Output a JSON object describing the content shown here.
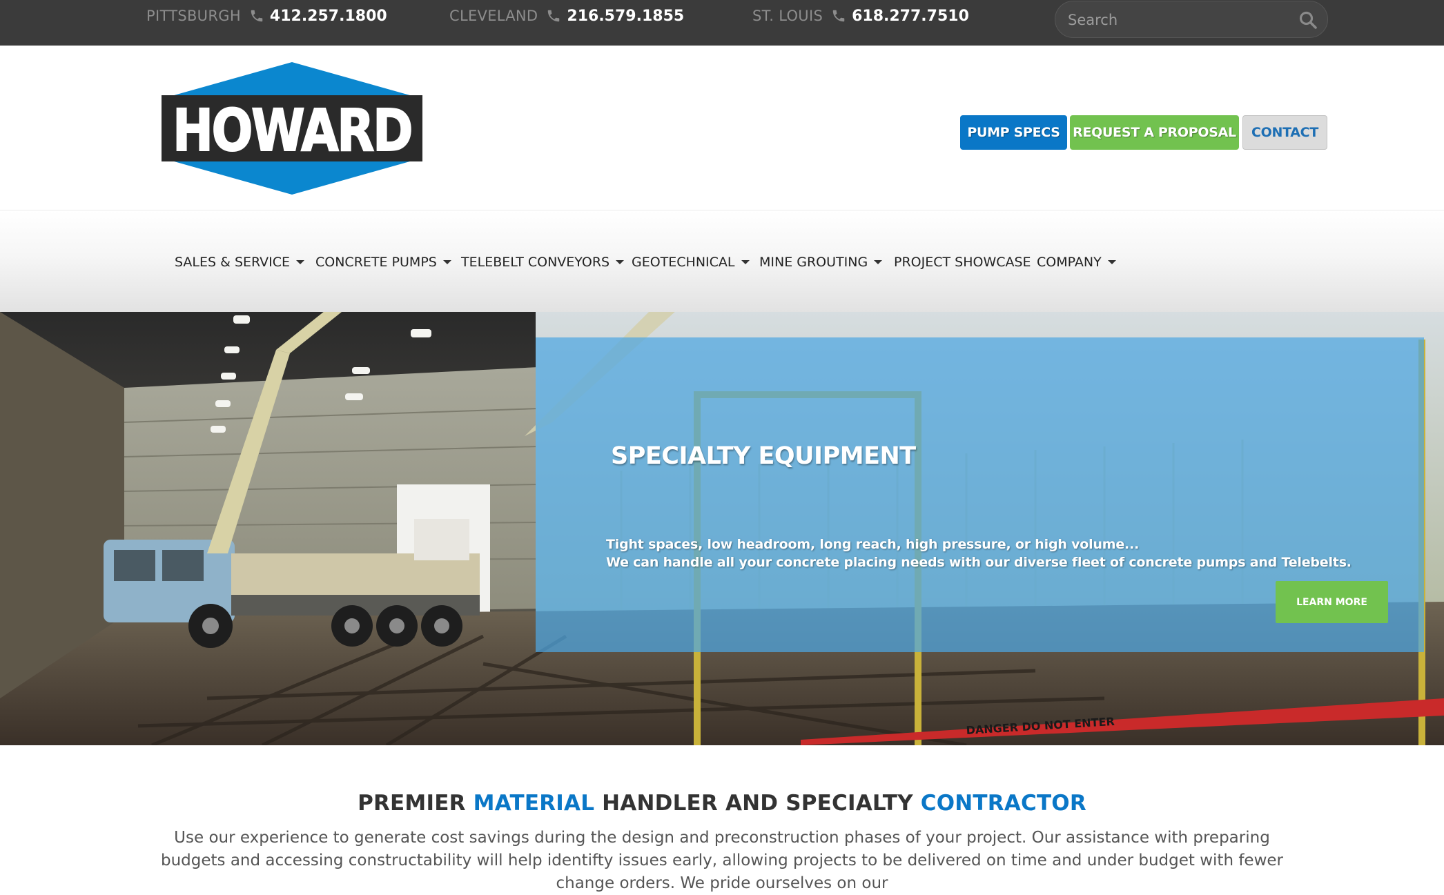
{
  "colors": {
    "topbar_bg": "#3b3b3b",
    "brand_blue": "#0a77c7",
    "brand_green": "#72c24f",
    "panel_blue": "#4ea6e2"
  },
  "topbar": {
    "locations": [
      {
        "city": "PITTSBURGH",
        "phone": "412.257.1800",
        "icon": "phone-icon"
      },
      {
        "city": "CLEVELAND",
        "phone": "216.579.1855",
        "icon": "phone-icon"
      },
      {
        "city": "ST. LOUIS",
        "phone": "618.277.7510",
        "icon": "phone-icon"
      }
    ],
    "search": {
      "placeholder": "Search",
      "icon": "search-icon"
    }
  },
  "header": {
    "logo_text": "HOWARD",
    "buttons": {
      "pump_specs": "PUMP SPECS",
      "request_proposal": "REQUEST A PROPOSAL",
      "contact": "CONTACT"
    }
  },
  "nav": {
    "items": [
      {
        "label": "SALES & SERVICE",
        "dropdown": true
      },
      {
        "label": "CONCRETE PUMPS",
        "dropdown": true
      },
      {
        "label": "TELEBELT CONVEYORS",
        "dropdown": true
      },
      {
        "label": "GEOTECHNICAL",
        "dropdown": true
      },
      {
        "label": "MINE GROUTING",
        "dropdown": true
      },
      {
        "label": "PROJECT SHOWCASE",
        "dropdown": false
      },
      {
        "label": "COMPANY",
        "dropdown": true
      }
    ]
  },
  "hero": {
    "title": "SPECIALTY EQUIPMENT",
    "line1": "Tight spaces, low headroom, long reach, high pressure, or high volume...",
    "line2": "We can handle all your concrete placing needs with our diverse fleet of concrete pumps and Telebelts.",
    "button": "LEARN MORE",
    "tape_text": "DANGER DO NOT ENTER"
  },
  "intro": {
    "heading": {
      "part1": "PREMIER ",
      "accent1": "MATERIAL",
      "part2": " HANDLER AND SPECIALTY ",
      "accent2": "CONTRACTOR"
    },
    "text": "Use our experience to generate cost savings during the design and preconstruction phases of your project. Our assistance with preparing budgets and accessing constructability will help identifty issues early, allowing projects to be delivered on time and under budget with fewer change orders. We pride ourselves on our"
  }
}
